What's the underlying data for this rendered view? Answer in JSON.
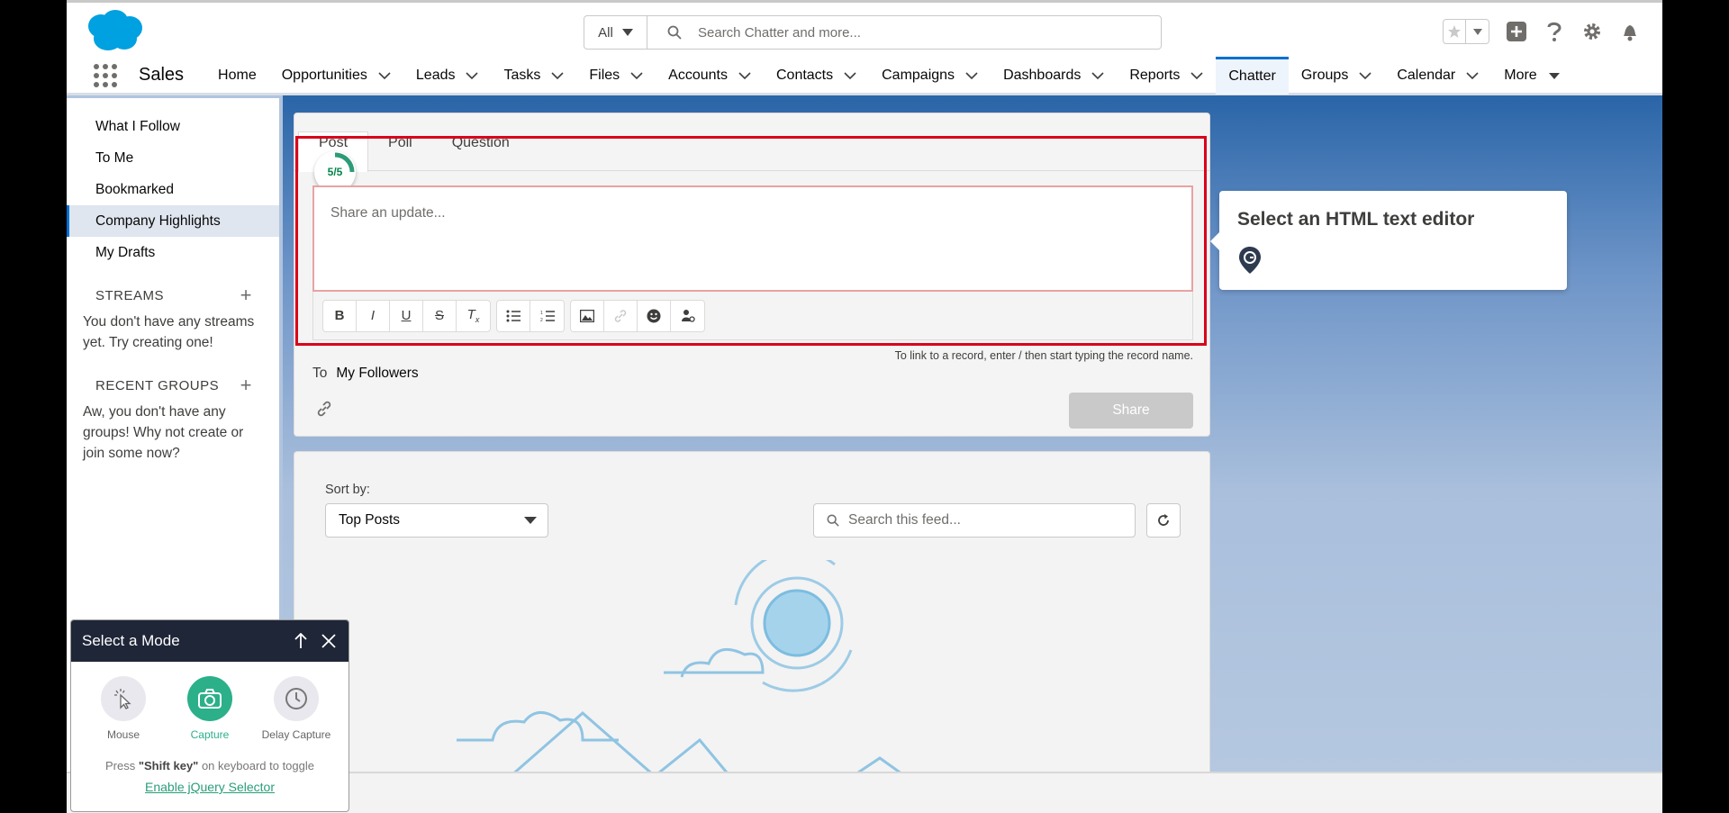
{
  "header": {
    "search_scope": "All",
    "search_placeholder": "Search Chatter and more..."
  },
  "nav": {
    "app_name": "Sales",
    "items": [
      {
        "label": "Home",
        "has_menu": false
      },
      {
        "label": "Opportunities",
        "has_menu": true
      },
      {
        "label": "Leads",
        "has_menu": true
      },
      {
        "label": "Tasks",
        "has_menu": true
      },
      {
        "label": "Files",
        "has_menu": true
      },
      {
        "label": "Accounts",
        "has_menu": true
      },
      {
        "label": "Contacts",
        "has_menu": true
      },
      {
        "label": "Campaigns",
        "has_menu": true
      },
      {
        "label": "Dashboards",
        "has_menu": true
      },
      {
        "label": "Reports",
        "has_menu": true
      },
      {
        "label": "Chatter",
        "has_menu": false,
        "active": true
      },
      {
        "label": "Groups",
        "has_menu": true
      },
      {
        "label": "Calendar",
        "has_menu": true
      },
      {
        "label": "More",
        "has_menu": true
      }
    ]
  },
  "sidebar": {
    "feeds": [
      "What I Follow",
      "To Me",
      "Bookmarked",
      "Company Highlights",
      "My Drafts"
    ],
    "active_feed": "Company Highlights",
    "streams_heading": "STREAMS",
    "streams_empty": "You don't have any streams yet. Try creating one!",
    "groups_heading": "RECENT GROUPS",
    "groups_empty": "Aw, you don't have any groups! Why not create or join some now?"
  },
  "publisher": {
    "tabs": [
      "Post",
      "Poll",
      "Question"
    ],
    "active_tab": "Post",
    "progress_text": "5/5",
    "textbox_placeholder": "Share an update...",
    "link_hint": "To link to a record, enter / then start typing the record name.",
    "to_label": "To",
    "to_value": "My Followers",
    "share_label": "Share"
  },
  "feed": {
    "sort_label": "Sort by:",
    "sort_value": "Top Posts",
    "search_placeholder": "Search this feed..."
  },
  "tooltip": {
    "title": "Select an HTML text editor"
  },
  "mode_widget": {
    "title": "Select a Mode",
    "options": [
      {
        "label": "Mouse",
        "active": false
      },
      {
        "label": "Capture",
        "active": true
      },
      {
        "label": "Delay Capture",
        "active": false
      }
    ],
    "hint_prefix": "Press ",
    "hint_key": "\"Shift key\"",
    "hint_suffix": " on keyboard to toggle",
    "link_label": "Enable jQuery Selector"
  },
  "colors": {
    "brand_blue": "#0070d2",
    "highlight_red": "#d9001b",
    "capture_green": "#2bb08a",
    "widget_header": "#1f2638"
  }
}
